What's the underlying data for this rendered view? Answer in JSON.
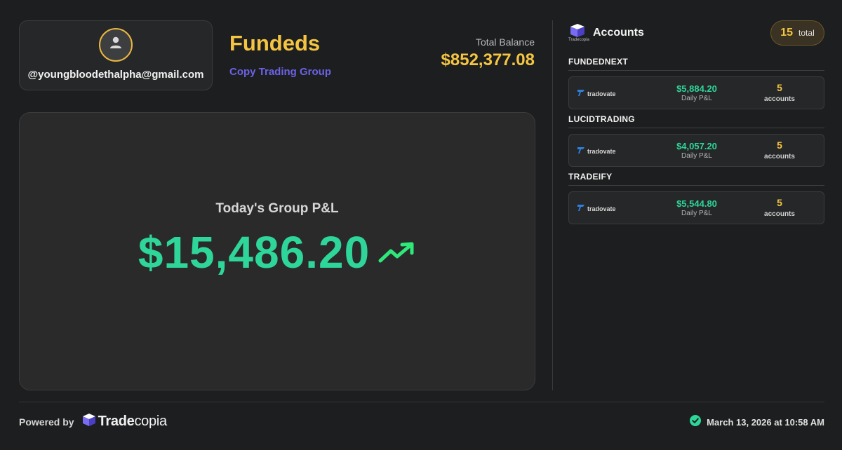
{
  "profile": {
    "email": "@youngbloodethalpha@gmail.com",
    "avatar_icon": "user-icon"
  },
  "group": {
    "title": "Fundeds",
    "subtitle": "Copy Trading Group"
  },
  "balance": {
    "label": "Total Balance",
    "value": "$852,377.08"
  },
  "pnl": {
    "label": "Today's Group P&L",
    "value": "$15,486.20",
    "trend_icon": "trending-up-icon"
  },
  "accounts": {
    "title": "Accounts",
    "logo_text": "Tradecopia",
    "total_count": "15",
    "total_label": "total",
    "sections": [
      {
        "name": "FUNDEDNEXT",
        "broker": "tradovate",
        "daily_pnl": "$5,884.20",
        "daily_label": "Daily P&L",
        "count": "5",
        "count_label": "accounts"
      },
      {
        "name": "LUCIDTRADING",
        "broker": "tradovate",
        "daily_pnl": "$4,057.20",
        "daily_label": "Daily P&L",
        "count": "5",
        "count_label": "accounts"
      },
      {
        "name": "TRADEIFY",
        "broker": "tradovate",
        "daily_pnl": "$5,544.80",
        "daily_label": "Daily P&L",
        "count": "5",
        "count_label": "accounts"
      }
    ]
  },
  "footer": {
    "powered_label": "Powered by",
    "brand_bold": "Trade",
    "brand_light": "copia",
    "timestamp": "March 13, 2026 at 10:58 AM",
    "check_icon": "check-circle-icon"
  },
  "colors": {
    "accent_gold": "#f5c542",
    "profit_green": "#2ed69a",
    "brand_purple": "#6b62e6",
    "background": "#1d1e1f"
  }
}
